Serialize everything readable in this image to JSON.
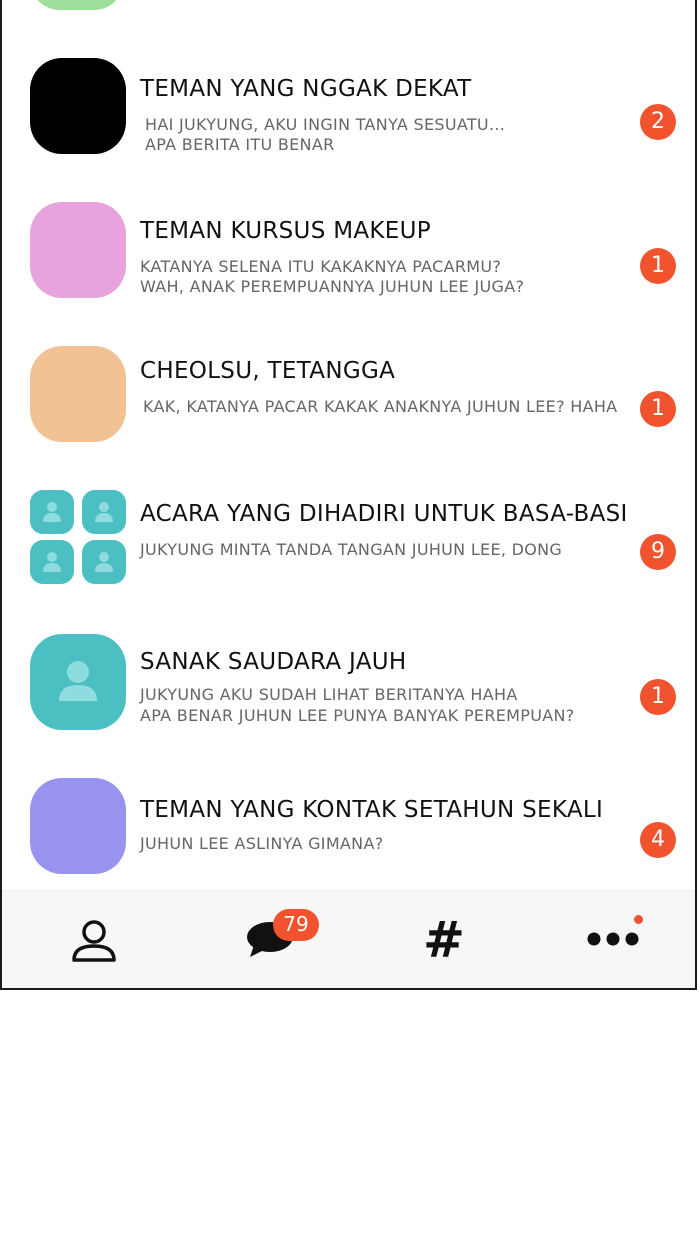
{
  "chats": [
    {
      "title": "TEMAN YANG NGGAK DEKAT",
      "lines": [
        "HAI JUKYUNG, AKU INGIN TANYA SESUATU...",
        "APA BERITA ITU BENAR"
      ],
      "badge": "2",
      "avatar_color": "#000000"
    },
    {
      "title": "TEMAN KURSUS MAKEUP",
      "lines": [
        "KATANYA SELENA ITU KAKAKNYA PACARMU?",
        "WAH, ANAK PEREMPUANNYA JUHUN LEE JUGA?"
      ],
      "badge": "1",
      "avatar_color": "#e8a3df"
    },
    {
      "title": "CHEOLSU, TETANGGA",
      "lines": [
        "KAK, KATANYA PACAR KAKAK ANAKNYA JUHUN LEE? HAHA"
      ],
      "badge": "1",
      "avatar_color": "#f2c194"
    },
    {
      "title": "ACARA YANG DIHADIRI UNTUK BASA-BASI",
      "lines": [
        "JUKYUNG MINTA TANDA TANGAN JUHUN LEE, DONG"
      ],
      "badge": "9",
      "avatar_color": "#4bbfc2"
    },
    {
      "title": "SANAK SAUDARA JAUH",
      "lines": [
        "JUKYUNG AKU SUDAH LIHAT BERITANYA HAHA",
        "APA BENAR JUHUN LEE PUNYA BANYAK PEREMPUAN?"
      ],
      "badge": "1",
      "avatar_color": "#4bbfc2"
    },
    {
      "title": "TEMAN YANG KONTAK SETAHUN SEKALI",
      "lines": [
        "JUHUN LEE ASLINYA GIMANA?"
      ],
      "badge": "4",
      "avatar_color": "#9793ee"
    }
  ],
  "tabbar": {
    "icons": [
      "person-icon",
      "chat-bubble-icon",
      "hashtag-icon",
      "more-icon"
    ],
    "chat_badge": "79",
    "hashtag_glyph": "#"
  },
  "colors": {
    "badge": "#f0532d",
    "prev_avatar": "#9edf9c",
    "teal": "#4bbfc2"
  }
}
